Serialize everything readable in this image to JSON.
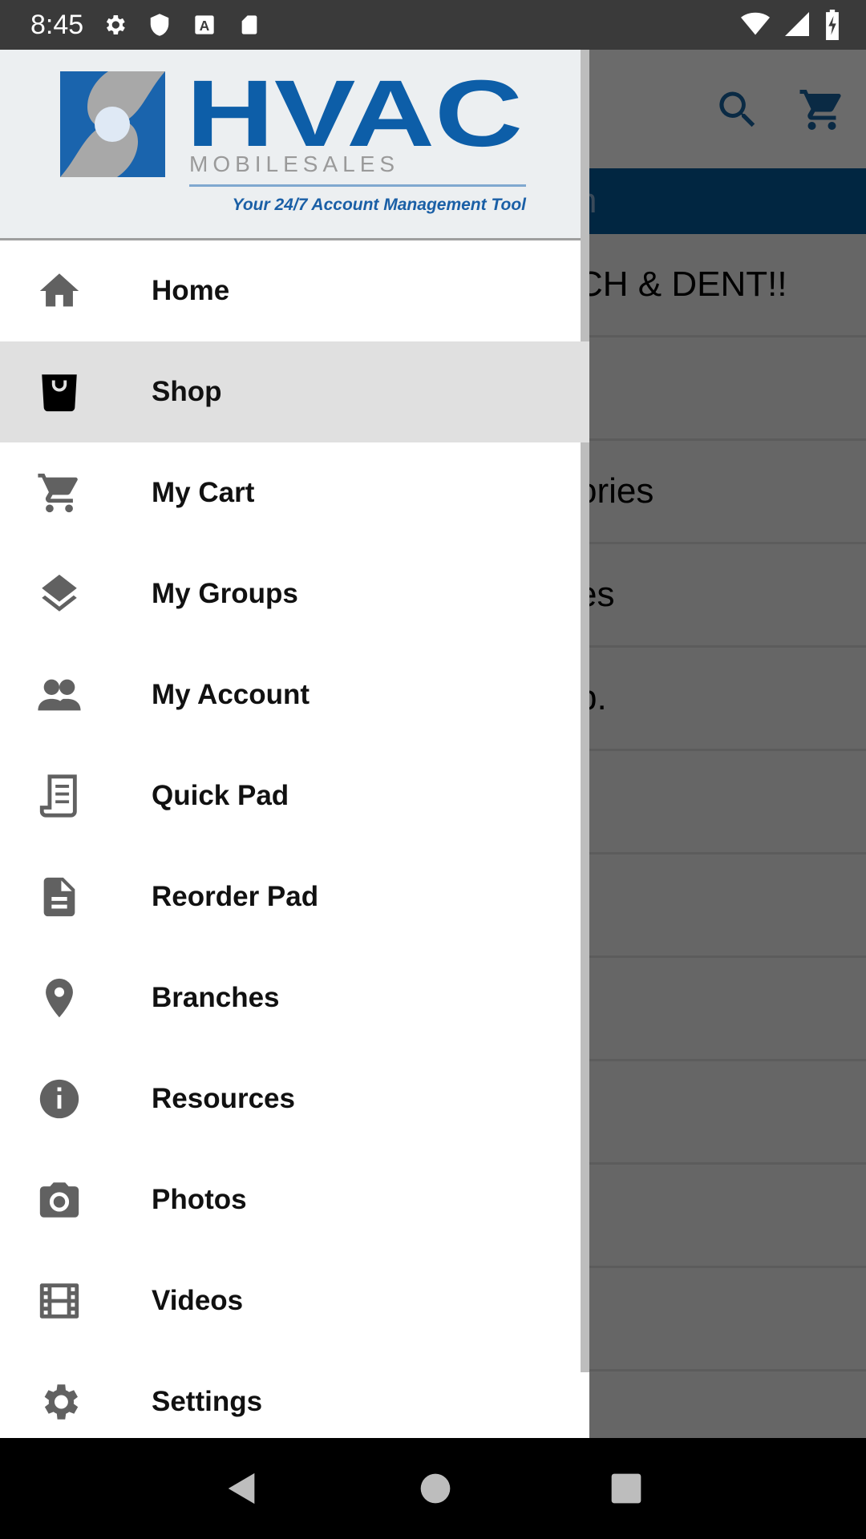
{
  "status_bar": {
    "time": "8:45",
    "icons": [
      "settings-icon",
      "shield-icon",
      "a-icon",
      "sd-card-icon"
    ],
    "right_icons": [
      "wifi-icon",
      "signal-icon",
      "battery-charging-icon"
    ]
  },
  "background": {
    "toolbar_icons": [
      "search-icon",
      "cart-icon"
    ],
    "banner_text": "n",
    "rows": [
      "CH & DENT!!",
      ":",
      "ories",
      "es",
      "p.",
      "",
      "",
      "",
      "",
      "",
      ""
    ]
  },
  "drawer": {
    "logo": {
      "title": "HVAC",
      "subtitle": "MOBILESALES",
      "tagline": "Your 24/7 Account Management Tool",
      "colors": {
        "blue": "#0d5ea8",
        "gray": "#9a9a9a"
      }
    },
    "items": [
      {
        "label": "Home",
        "icon": "home-icon"
      },
      {
        "label": "Shop",
        "icon": "shopping-bag-icon",
        "active": true
      },
      {
        "label": "My Cart",
        "icon": "cart-icon"
      },
      {
        "label": "My Groups",
        "icon": "layers-icon"
      },
      {
        "label": "My Account",
        "icon": "people-icon"
      },
      {
        "label": "Quick Pad",
        "icon": "receipt-icon"
      },
      {
        "label": "Reorder Pad",
        "icon": "document-icon"
      },
      {
        "label": "Branches",
        "icon": "location-pin-icon"
      },
      {
        "label": "Resources",
        "icon": "info-icon"
      },
      {
        "label": "Photos",
        "icon": "camera-icon"
      },
      {
        "label": "Videos",
        "icon": "film-icon"
      },
      {
        "label": "Settings",
        "icon": "gear-icon"
      }
    ]
  },
  "nav_bar": {
    "buttons": [
      "back-icon",
      "home-icon",
      "recents-icon"
    ]
  }
}
